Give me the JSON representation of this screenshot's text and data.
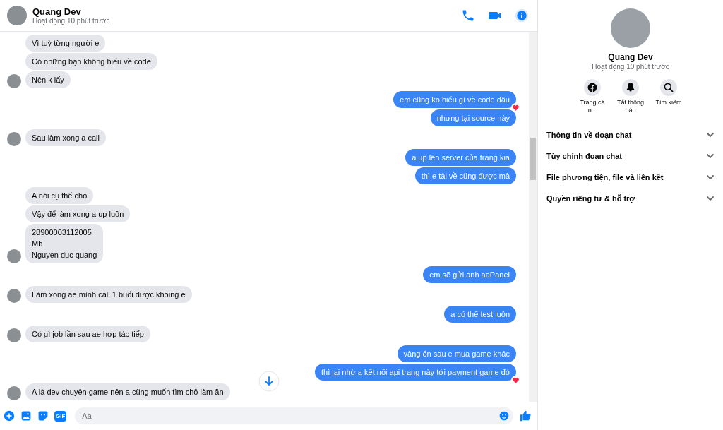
{
  "header": {
    "name": "Quang Dev",
    "status": "Hoạt động 10 phút trước"
  },
  "groups": [
    {
      "kind": "incoming",
      "messages": [
        {
          "text": "Vì tuỳ từng người e",
          "reacted": false
        },
        {
          "text": "Có những bạn không hiểu về code",
          "reacted": false
        },
        {
          "text": "Nên k lấy",
          "reacted": false
        }
      ]
    },
    {
      "kind": "outgoing",
      "messages": [
        {
          "text": "em cũng ko hiểu gì về code đâu",
          "reacted": true
        },
        {
          "text": "nhưng tại source này",
          "reacted": false
        }
      ]
    },
    {
      "kind": "incoming",
      "messages": [
        {
          "text": "Sau làm xong a call",
          "reacted": false
        }
      ]
    },
    {
      "kind": "outgoing",
      "messages": [
        {
          "text": "a up lên server của trang kia",
          "reacted": false
        },
        {
          "text": "thì e tải về cũng được mà",
          "reacted": false
        }
      ]
    },
    {
      "kind": "incoming",
      "messages": [
        {
          "text": "A nói cụ thể cho",
          "reacted": false
        },
        {
          "text": "Vậy để làm xong a up luôn",
          "reacted": false
        },
        {
          "text": "28900003112005\nMb\nNguyen duc quang",
          "reacted": false
        }
      ]
    },
    {
      "kind": "outgoing",
      "messages": [
        {
          "text": "em sẽ gửi anh aaPanel",
          "reacted": false
        }
      ]
    },
    {
      "kind": "incoming",
      "messages": [
        {
          "text": "Làm xong ae mình call 1 buổi được khoing e",
          "reacted": false
        }
      ]
    },
    {
      "kind": "outgoing",
      "messages": [
        {
          "text": "a có thể test luôn",
          "reacted": false
        }
      ]
    },
    {
      "kind": "incoming",
      "messages": [
        {
          "text": "Có gì job lần sau ae hợp tác tiếp",
          "reacted": false
        }
      ]
    },
    {
      "kind": "outgoing",
      "messages": [
        {
          "text": "vâng ổn sau e mua game khác",
          "reacted": false
        },
        {
          "text": "thì lại nhờ a kết nối api trang này tới payment game đó",
          "reacted": true
        }
      ]
    },
    {
      "kind": "incoming",
      "messages": [
        {
          "text": "A là dev chuyên game nên a cũng muốn tìm chỗ làm ăn",
          "reacted": false
        }
      ]
    }
  ],
  "composer": {
    "gif_label": "GIF",
    "placeholder": "Aa"
  },
  "profile": {
    "name": "Quang Dev",
    "status": "Hoạt động 10 phút trước",
    "actions": [
      {
        "kind": "profile",
        "label": "Trang cá n..."
      },
      {
        "kind": "mute",
        "label": "Tắt thông báo"
      },
      {
        "kind": "search",
        "label": "Tìm kiếm"
      }
    ],
    "sections": [
      {
        "label": "Thông tin về đoạn chat",
        "expanded": false
      },
      {
        "label": "Tùy chỉnh đoạn chat",
        "expanded": false
      },
      {
        "label": "File phương tiện, file và liên kết",
        "expanded": false
      },
      {
        "label": "Quyền riêng tư & hỗ trợ",
        "expanded": false
      }
    ]
  }
}
